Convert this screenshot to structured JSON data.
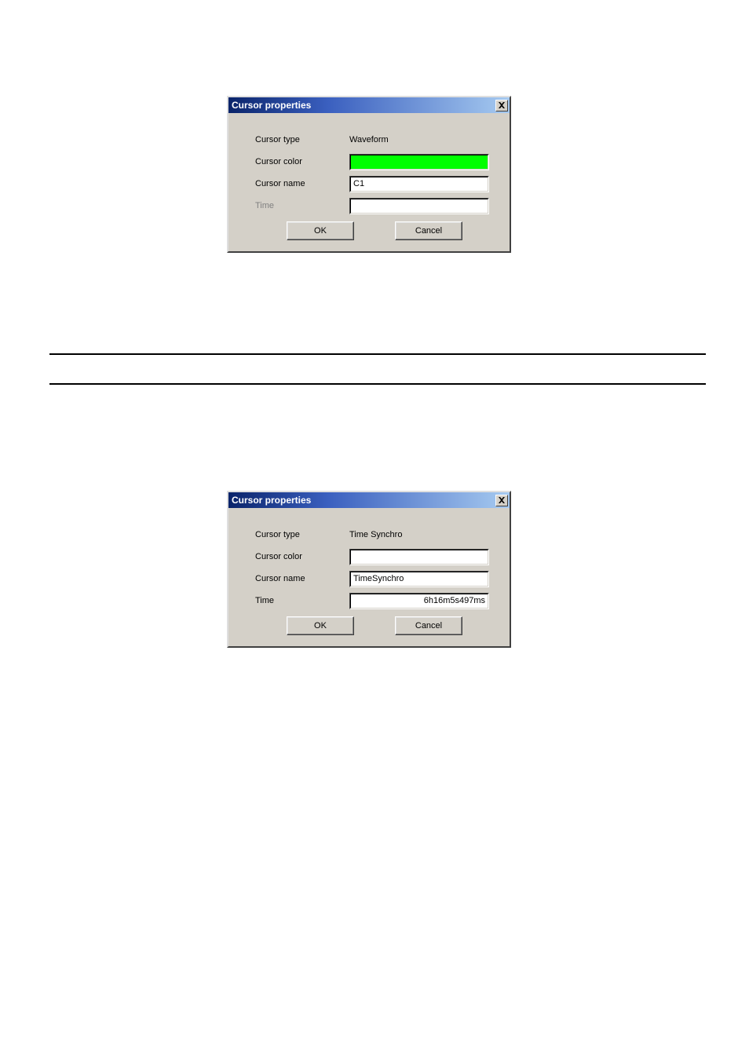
{
  "dialog1": {
    "title": "Cursor properties",
    "rows": {
      "type_label": "Cursor type",
      "type_value": "Waveform",
      "color_label": "Cursor color",
      "color_value": "#00ff00",
      "name_label": "Cursor name",
      "name_value": "C1",
      "time_label": "Time",
      "time_value": "",
      "time_disabled": true
    },
    "buttons": {
      "ok": "OK",
      "cancel": "Cancel"
    }
  },
  "dialog2": {
    "title": "Cursor properties",
    "rows": {
      "type_label": "Cursor type",
      "type_value": "Time Synchro",
      "color_label": "Cursor color",
      "color_value": "#ffffff",
      "name_label": "Cursor name",
      "name_value": "TimeSynchro",
      "time_label": "Time",
      "time_value": "6h16m5s497ms",
      "time_disabled": false
    },
    "buttons": {
      "ok": "OK",
      "cancel": "Cancel"
    }
  }
}
